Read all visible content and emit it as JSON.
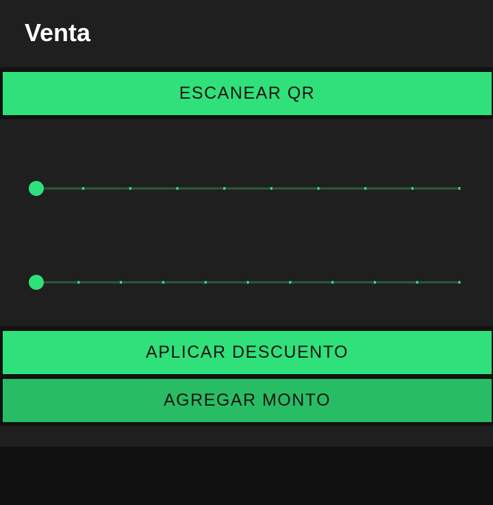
{
  "header": {
    "title": "Venta"
  },
  "actions": {
    "scan_qr_label": "ESCANEAR QR",
    "apply_discount_label": "APLICAR DESCUENTO",
    "add_amount_label": "AGREGAR MONTO"
  },
  "sliders": [
    {
      "level": 0,
      "steps": 9
    },
    {
      "level": 0,
      "steps": 10
    }
  ],
  "colors": {
    "accent": "#30e07a",
    "accent_dark": "#28bd64",
    "track": "#2e5a3f",
    "background": "#1f1f1f"
  }
}
